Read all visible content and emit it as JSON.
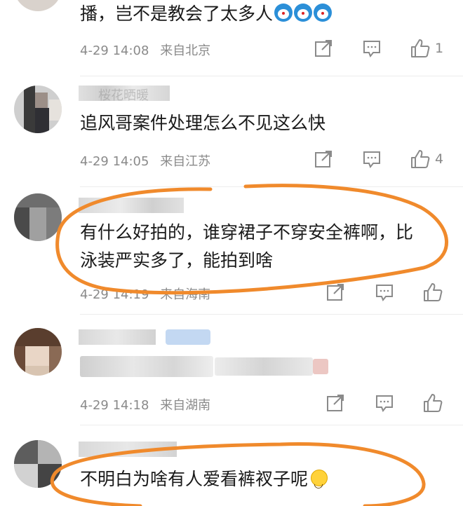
{
  "comments": [
    {
      "text": "播，岂不是教会了太多人",
      "time": "4-29 14:08",
      "location": "来自北京",
      "likes": "1"
    },
    {
      "username": "桜花晒暖",
      "text": "追风哥案件处理怎么不见这么快",
      "time": "4-29 14:05",
      "location": "来自江苏",
      "likes": "4"
    },
    {
      "text_line1": "有什么好拍的，谁穿裙子不穿安全裤啊，比",
      "text_line2": "泳装严实多了，能拍到啥",
      "time": "4-29 14:19",
      "location": "来自海南",
      "likes": ""
    },
    {
      "time": "4-29 14:18",
      "location": "来自湖南",
      "likes": ""
    },
    {
      "text": "不明白为啥有人爱看裤衩子呢"
    }
  ],
  "icons": [
    "share-icon",
    "comment-icon",
    "like-icon",
    "doraemon-emoji-icon",
    "smile-emoji-icon"
  ],
  "colors": {
    "annotation": "#f08a2c",
    "meta": "#8a8a8a",
    "text": "#1a1a1a"
  }
}
